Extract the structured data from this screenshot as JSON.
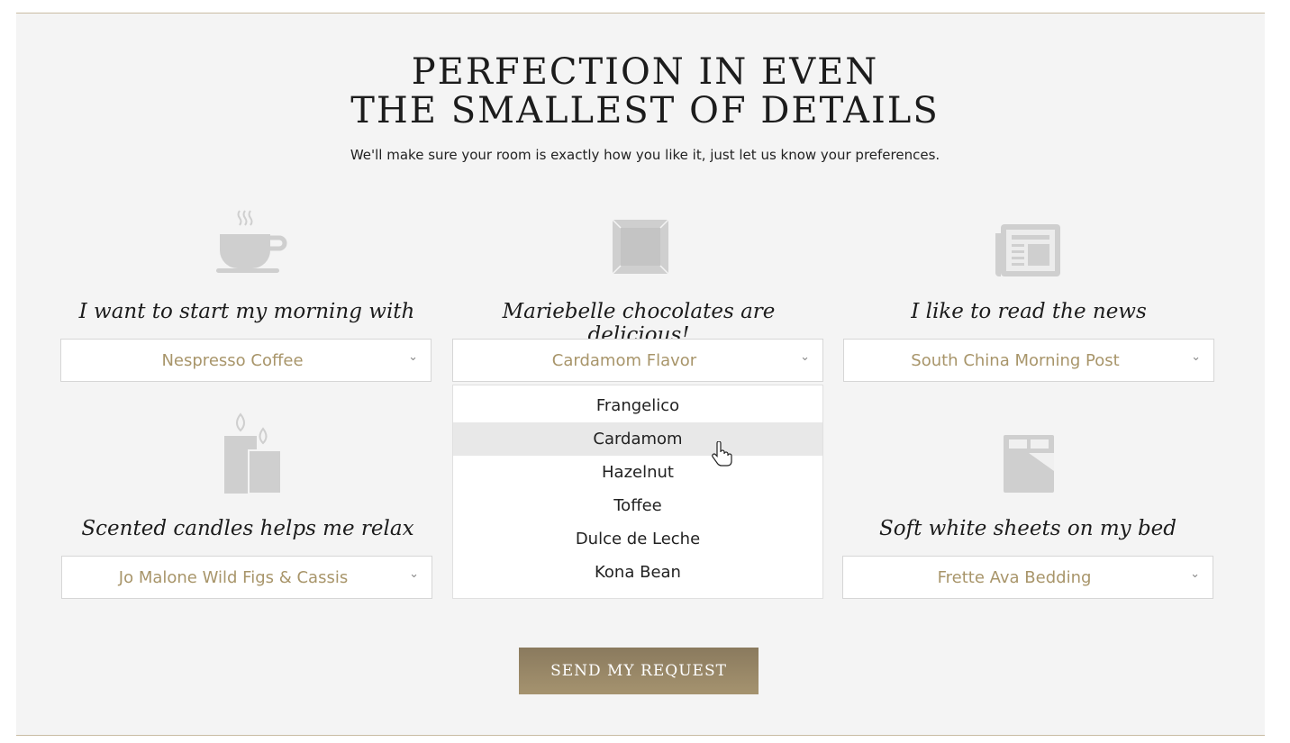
{
  "header": {
    "title_line1": "PERFECTION IN EVEN",
    "title_line2": "THE SMALLEST OF DETAILS",
    "subtitle": "We'll make sure your room is exactly how you like it, just let us know your preferences."
  },
  "preferences": [
    {
      "icon": "coffee-cup-icon",
      "label": "I want to start my morning with",
      "selected": "Nespresso Coffee"
    },
    {
      "icon": "chocolate-box-icon",
      "label": "Mariebelle chocolates are delicious!",
      "selected": "Cardamom Flavor"
    },
    {
      "icon": "newspaper-icon",
      "label": "I like to read the news",
      "selected": "South China Morning Post"
    },
    {
      "icon": "candles-icon",
      "label": "Scented candles helps me relax",
      "selected": "Jo Malone Wild Figs & Cassis"
    },
    {
      "icon": "bed-icon",
      "label": "Soft white sheets on my bed",
      "selected": "Frette Ava Bedding"
    }
  ],
  "chocolate_dropdown": {
    "options": [
      "Frangelico",
      "Cardamom",
      "Hazelnut",
      "Toffee",
      "Dulce de Leche",
      "Kona Bean"
    ],
    "highlighted": "Cardamom"
  },
  "actions": {
    "send_label": "SEND MY REQUEST"
  },
  "colors": {
    "accent_gold": "#a8956a",
    "button": "#968665",
    "icon_grey": "#cfcfcf"
  }
}
